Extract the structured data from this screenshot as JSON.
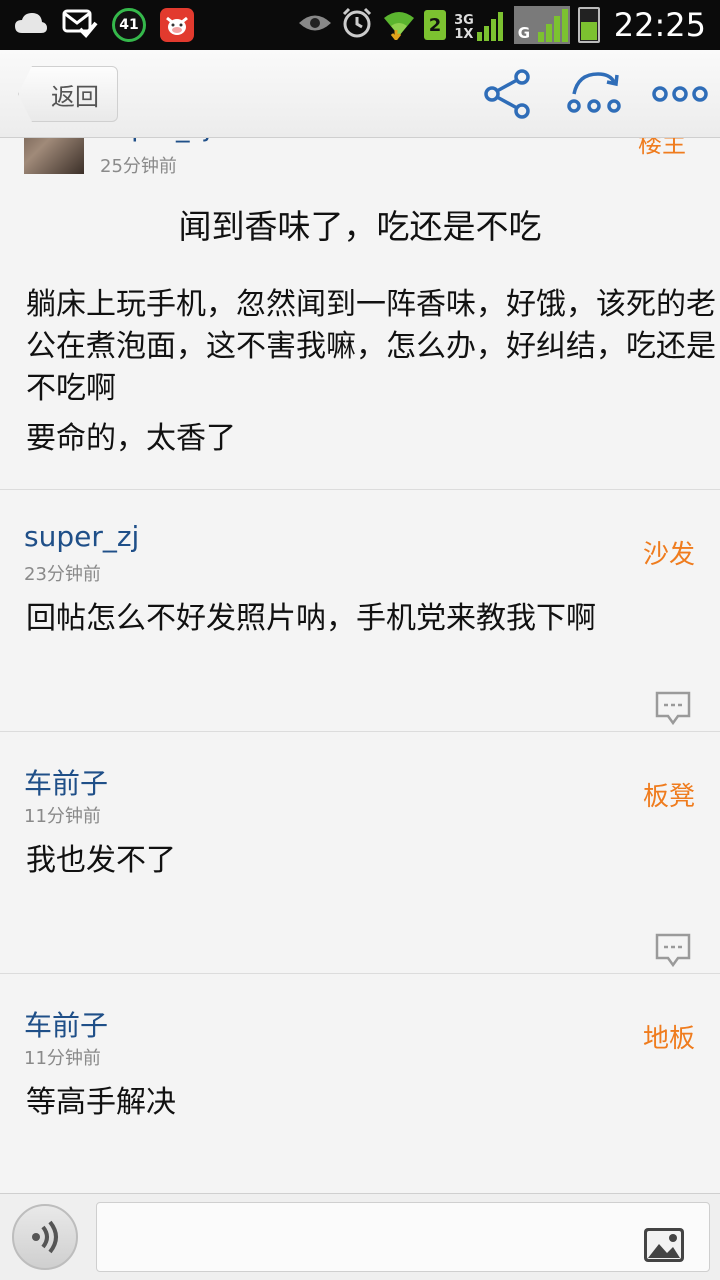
{
  "status_bar": {
    "icons_left": [
      "cloud-icon",
      "mail-check-icon",
      "circle-meter-icon",
      "cow-app-icon"
    ],
    "meter_value": "41",
    "icons_right": [
      "eye-icon",
      "alarm-icon",
      "wifi-icon",
      "sim2-icon",
      "signal-3g-icon",
      "signal-g-icon",
      "battery-icon"
    ],
    "sim_number": "2",
    "net_type_top": "3G",
    "net_type_bottom": "1X",
    "g_label": "G",
    "time": "22:25"
  },
  "header": {
    "back_label": "返回",
    "icons": [
      "share-icon",
      "refresh-loop-icon",
      "more-icon"
    ]
  },
  "original_post": {
    "username": "super_zj",
    "time": "25分钟前",
    "floor": "楼主",
    "title": "闻到香味了，吃还是不吃",
    "body": "躺床上玩手机，忽然闻到一阵香味，好饿，该死的老公在煮泡面，这不害我嘛，怎么办，好纠结，吃还是不吃啊",
    "body2": "要命的，太香了"
  },
  "replies": [
    {
      "username": "super_zj",
      "time": "23分钟前",
      "floor": "沙发",
      "text": "回帖怎么不好发照片呐，手机党来教我下啊"
    },
    {
      "username": "车前子",
      "time": "11分钟前",
      "floor": "板凳",
      "text": "我也发不了"
    },
    {
      "username": "车前子",
      "time": "11分钟前",
      "floor": "地板",
      "text": "等高手解决"
    }
  ],
  "bottom_bar": {
    "input_value": "",
    "input_placeholder": ""
  },
  "colors": {
    "username": "#1f4f88",
    "floor": "#ef7c1e",
    "background": "#f4f4f4"
  }
}
